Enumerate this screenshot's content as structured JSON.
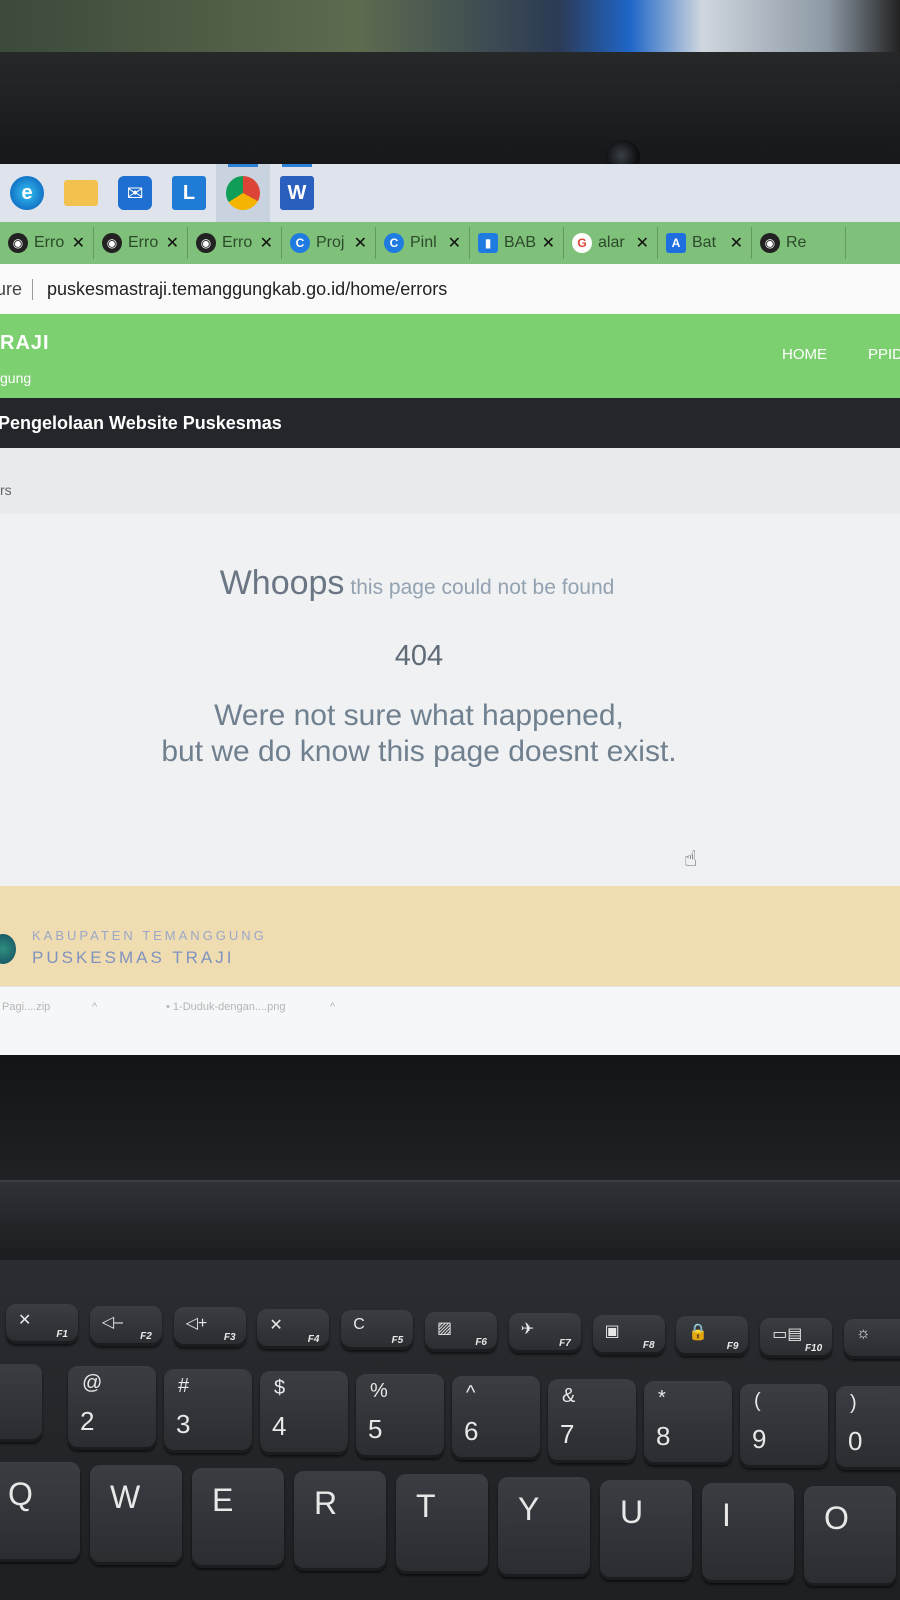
{
  "browser": {
    "tabs": [
      {
        "label": "Erro",
        "icon": "globe-icon"
      },
      {
        "label": "Erro",
        "icon": "globe-icon"
      },
      {
        "label": "Erro",
        "icon": "globe-icon"
      },
      {
        "label": "Proj",
        "icon": "c-circle-icon"
      },
      {
        "label": "Pinl",
        "icon": "c-circle-icon"
      },
      {
        "label": "BAB",
        "icon": "document-icon"
      },
      {
        "label": "alar",
        "icon": "google-icon"
      },
      {
        "label": "Bat",
        "icon": "a-square-icon"
      },
      {
        "label": "Re",
        "icon": "globe-icon"
      }
    ],
    "tab_close": "✕",
    "address": {
      "secure_label": "ure",
      "url": "puskesmastraji.temanggungkab.go.id/home/errors"
    }
  },
  "site": {
    "brand": "RAJI",
    "brand_sub": "gung",
    "nav": {
      "home": "HOME",
      "ppid": "PPID"
    },
    "subheader": "Pengelolaan Website Puskesmas",
    "breadcrumb": "rs"
  },
  "error": {
    "whoops": "Whoops",
    "whoops_sub": "this page could not be found",
    "code": "404",
    "line1": "Were not sure what happened,",
    "line2": "but we do know this page doesnt exist."
  },
  "footer": {
    "kabupaten": "KABUPATEN TEMANGGUNG",
    "puskesmas": "PUSKESMAS TRAJI"
  },
  "downloads": {
    "item1": "Pagi....zip",
    "item2": "1-Duduk-dengan....png",
    "caret": "^"
  },
  "keyboard": {
    "fn_keys": [
      {
        "sub": "F1",
        "icon": "mute-icon"
      },
      {
        "sub": "F2",
        "icon": "volume-down-icon"
      },
      {
        "sub": "F3",
        "icon": "volume-up-icon"
      },
      {
        "sub": "F4",
        "icon": "mic-mute-icon"
      },
      {
        "sub": "F5",
        "icon": "refresh-icon"
      },
      {
        "sub": "F6",
        "icon": "touchpad-icon"
      },
      {
        "sub": "F7",
        "icon": "airplane-icon"
      },
      {
        "sub": "F8",
        "icon": "camera-off-icon"
      },
      {
        "sub": "F9",
        "icon": "lock-icon"
      },
      {
        "sub": "F10",
        "icon": "display-icon"
      },
      {
        "sub": "",
        "icon": "brightness-icon"
      }
    ],
    "fn_glyphs": [
      "✕",
      "◁–",
      "◁+",
      "✕",
      "C",
      "▨",
      "✈",
      "▣",
      "🔒",
      "▭▤",
      "☼"
    ],
    "number_keys": [
      {
        "top": "@",
        "main": "2"
      },
      {
        "top": "#",
        "main": "3"
      },
      {
        "top": "$",
        "main": "4"
      },
      {
        "top": "%",
        "main": "5"
      },
      {
        "top": "^",
        "main": "6"
      },
      {
        "top": "&",
        "main": "7"
      },
      {
        "top": "*",
        "main": "8"
      },
      {
        "top": "(",
        "main": "9"
      },
      {
        "top": ")",
        "main": "0"
      }
    ],
    "letter_keys": [
      "Q",
      "W",
      "E",
      "R",
      "T",
      "Y",
      "U",
      "I",
      "O"
    ]
  }
}
